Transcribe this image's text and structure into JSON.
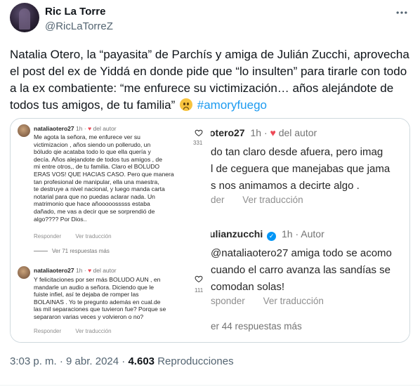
{
  "author": {
    "name": "Ric La Torre",
    "handle": "@RicLaTorreZ"
  },
  "tweet": {
    "text": "Natalia Otero, la “payasita” de Parchís y amiga de Julián Zucchi, aprovecha el post del ex de Yiddá en donde pide que “lo insulten” para tirarle con todo a la ex combatiente: “me enfurece su victimización… años alejándote de todos tus amigos, de tu familia”",
    "hashtag": "#amoryfuego"
  },
  "meta": {
    "time": "3:03 p. m.",
    "separator": "·",
    "date": "9 abr. 2024",
    "views_count": "4.603",
    "views_label": "Reproducciones"
  },
  "screenshot_left": {
    "comment1": {
      "user": "nataliaotero27",
      "time": "1h",
      "heart": "♥",
      "author_tag": "del autor",
      "lines": [
        "Me agota la señora, me enfurece ver su",
        "victimizacion , años siendo un pollerudo, un",
        "bóludo qie acataba todo lo que ella quería y",
        "decía.  Años alejandote de todos  tus amigos , de",
        "mi entre otros,, de tu familia.  Claro el BOLUDO",
        "ERAS VOS! QUE HACIAS CASO. Pero que manera",
        "tan profesional de manipular,  ella una maestra,",
        "te destruye a nivel nacional, y luego manda carta",
        "notarial para que no puedas aclarar nada.  Un",
        "matrimonio que hace añooooosssss estaba",
        "dañado, me vas a decir que se sorprendió de",
        "algo???? Por Dios.."
      ],
      "reply": "Responder",
      "translate": "Ver traducción",
      "likes": "331",
      "more_replies": "Ver 71 respuestas más"
    },
    "comment2": {
      "user": "nataliaotero27",
      "time": "1h",
      "heart": "♥",
      "author_tag": "del autor",
      "lines": [
        "Y felicitaciones por ser más BOLUDO AUN , en",
        "mandarle un audio a señora. Diciendo que le",
        "fuiste infiel, así te dejaba de romper las",
        "BOLAINAS .  Yo te pregunto además en cual.de",
        "las mil separaciones que tuvieron fue?  Porque se",
        "separaron varias veces y volvieron o no?"
      ],
      "reply": "Responder",
      "translate": "Ver traducción",
      "likes": "111"
    }
  },
  "screenshot_right": {
    "comment1": {
      "user": "otero27",
      "time": "1h",
      "heart": "♥",
      "author_tag": "del autor",
      "lines": [
        "do tan claro desde afuera,  pero imag",
        "l de ceguera que manejabas que jama",
        "s nos animamos a decirte algo ."
      ],
      "reply": "der",
      "translate": "Ver traducción"
    },
    "comment2": {
      "user": "ulianzucchi",
      "verified": "✓",
      "time": "1h",
      "author_tag": "Autor",
      "lines": [
        "@nataliaotero27 amiga todo se acomo",
        "cuando el carro avanza las sandías se",
        "comodan solas!"
      ],
      "reply": "sponder",
      "translate": "Ver traducción",
      "more_replies": "er 44 respuestas más"
    }
  },
  "icons": {
    "more": "more-horizontal-icon",
    "like": "heart-outline-icon",
    "verified": "verified-badge-icon"
  },
  "colors": {
    "link_blue": "#1d9bf0",
    "secondary": "#536471",
    "insta_heart": "#ed4956",
    "verified": "#0095f6"
  }
}
